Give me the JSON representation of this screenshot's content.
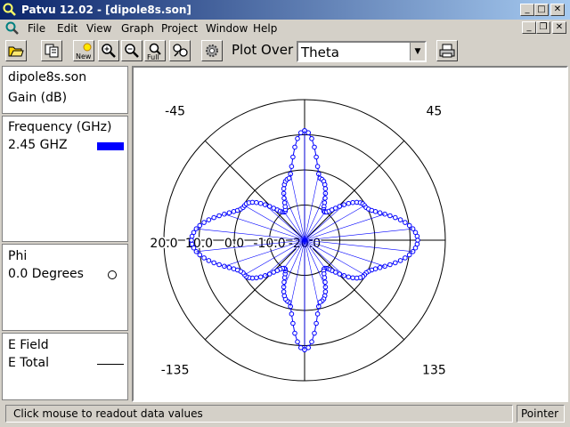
{
  "window": {
    "title": "Patvu 12.02 - [dipole8s.son]"
  },
  "menu": [
    "File",
    "Edit",
    "View",
    "Graph",
    "Project",
    "Window",
    "Help"
  ],
  "toolbar": {
    "icons": [
      "open-icon",
      "copy-icon",
      "new-plot-icon",
      "zoom-in-icon",
      "zoom-out-icon",
      "zoom-full-icon",
      "pan-icon",
      "settings-icon",
      "print-icon"
    ],
    "new_label": "New",
    "full_label": "Full",
    "plot_over_label": "Plot Over",
    "plot_over_value": "Theta"
  },
  "panels": {
    "file": {
      "name": "dipole8s.son",
      "quantity": "Gain (dB)"
    },
    "frequency": {
      "header": "Frequency (GHz)",
      "value": "2.45 GHZ",
      "swatch_color": "#0000ff"
    },
    "phi": {
      "header": "Phi",
      "value": "0.0 Degrees"
    },
    "field": {
      "header": "E Field",
      "value": "E Total"
    }
  },
  "chart_data": {
    "type": "polar",
    "radial_labels": [
      "20.0",
      "10.0",
      "0.0",
      "-10.0",
      "-20.0"
    ],
    "angle_labels": [
      "-45",
      "45",
      "-135",
      "135"
    ],
    "series": [
      {
        "name": "2.45 GHZ",
        "color": "#0000ff",
        "marker": "circle",
        "points": [
          {
            "theta": 0,
            "r": 0.95
          },
          {
            "theta": 15,
            "r": 0.55
          },
          {
            "theta": 35,
            "r": 0.3
          },
          {
            "theta": 60,
            "r": 0.6
          },
          {
            "theta": 90,
            "r": 0.98
          },
          {
            "theta": 120,
            "r": 0.6
          },
          {
            "theta": 145,
            "r": 0.3
          },
          {
            "theta": 165,
            "r": 0.55
          },
          {
            "theta": 180,
            "r": 0.95
          }
        ]
      }
    ]
  },
  "status": {
    "message": "Click mouse to readout data values",
    "mode": "Pointer"
  }
}
